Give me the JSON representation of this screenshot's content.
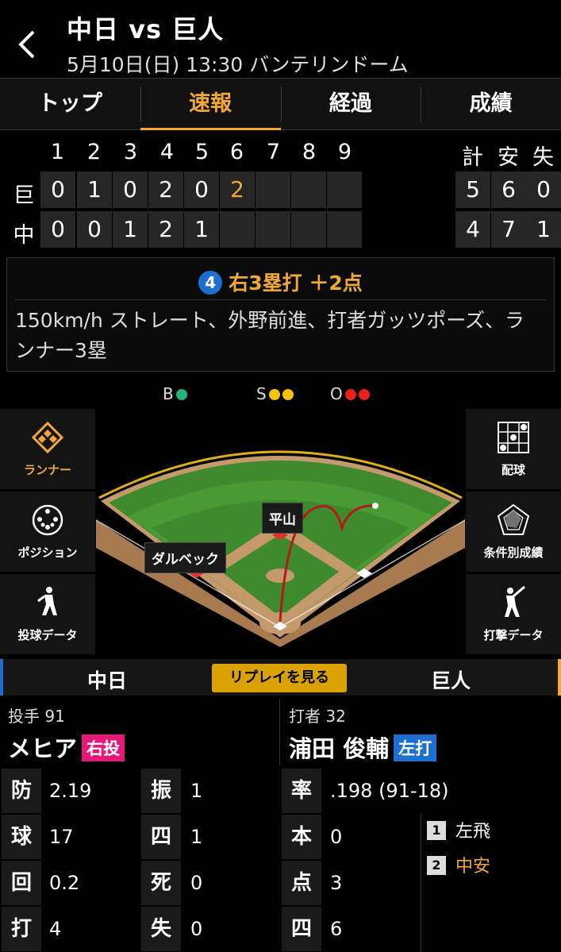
{
  "header": {
    "title": "中日 vs 巨人",
    "subtitle": "5月10日(日) 13:30 バンテリンドーム"
  },
  "tabs": [
    {
      "label": "トップ",
      "active": false
    },
    {
      "label": "速報",
      "active": true
    },
    {
      "label": "経過",
      "active": false
    },
    {
      "label": "成績",
      "active": false
    }
  ],
  "scoreboard": {
    "innings": [
      "1",
      "2",
      "3",
      "4",
      "5",
      "6",
      "7",
      "8",
      "9"
    ],
    "totals_headers": [
      "計",
      "安",
      "失"
    ],
    "teams": [
      {
        "abbr": "巨",
        "runs": [
          "0",
          "1",
          "0",
          "2",
          "0",
          "2",
          "",
          "",
          ""
        ],
        "totals": [
          "5",
          "6",
          "0"
        ]
      },
      {
        "abbr": "中",
        "runs": [
          "0",
          "0",
          "1",
          "2",
          "1",
          "",
          "",
          "",
          ""
        ],
        "totals": [
          "4",
          "7",
          "1"
        ]
      }
    ]
  },
  "play": {
    "number": "4",
    "headline": "右3塁打 ＋2点",
    "description": "150km/h ストレート、外野前進、打者ガッツポーズ、ランナー3塁"
  },
  "count": {
    "balls_label": "B",
    "balls": 1,
    "strikes_label": "S",
    "strikes": 2,
    "outs_label": "O",
    "outs": 2,
    "colors": {
      "ball": "#22b573",
      "strike": "#f5c400",
      "out": "#e8231f"
    }
  },
  "side_buttons": {
    "left": [
      {
        "label": "ランナー",
        "icon": "runner-diamond-icon",
        "active": true
      },
      {
        "label": "ポジション",
        "icon": "position-icon",
        "active": false
      },
      {
        "label": "投球データ",
        "icon": "pitcher-icon",
        "active": false
      }
    ],
    "right": [
      {
        "label": "配球",
        "icon": "pitch-grid-icon",
        "active": false
      },
      {
        "label": "条件別成績",
        "icon": "radar-chart-icon",
        "active": false
      },
      {
        "label": "打撃データ",
        "icon": "batter-icon",
        "active": false
      }
    ]
  },
  "field": {
    "fielder_labels": [
      "平山",
      "ダルベック"
    ]
  },
  "teambar": {
    "home": "中日",
    "away": "巨人",
    "replay_label": "リプレイを見る"
  },
  "pitcher": {
    "role": "投手 91",
    "name": "メヒア",
    "hand": "右投",
    "hand_color": "#e6197a"
  },
  "batter": {
    "role": "打者 32",
    "name": "浦田 俊輔",
    "hand": "左打",
    "hand_color": "#1e6fd0"
  },
  "pitcher_stats": [
    {
      "k": "防",
      "v": "2.19"
    },
    {
      "k": "球",
      "v": "17"
    },
    {
      "k": "回",
      "v": "0.2"
    },
    {
      "k": "打",
      "v": "4"
    }
  ],
  "pitcher_stats2": [
    {
      "k": "振",
      "v": "1"
    },
    {
      "k": "四",
      "v": "1"
    },
    {
      "k": "死",
      "v": "0"
    },
    {
      "k": "失",
      "v": "0"
    }
  ],
  "batter_stats": [
    {
      "k": "率",
      "v": ".198 (91-18)"
    },
    {
      "k": "本",
      "v": "0"
    },
    {
      "k": "点",
      "v": "3"
    },
    {
      "k": "四",
      "v": "6"
    }
  ],
  "at_bat_history": [
    {
      "n": "1",
      "result": "左飛",
      "highlight": false
    },
    {
      "n": "2",
      "result": "中安",
      "highlight": true
    }
  ],
  "colors": {
    "accent": "#f0a938"
  }
}
